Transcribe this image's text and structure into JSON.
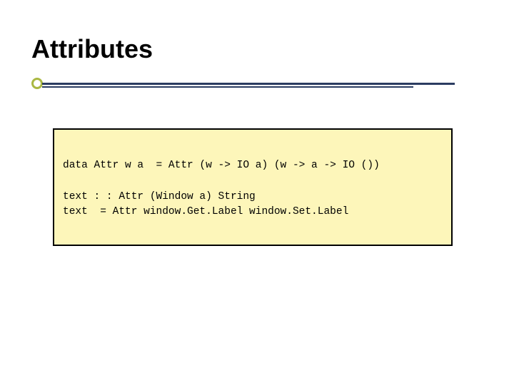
{
  "slide": {
    "title": "Attributes",
    "code": "data Attr w a  = Attr (w -> IO a) (w -> a -> IO ())\n\ntext : : Attr (Window a) String\ntext  = Attr window.Get.Label window.Set.Label"
  }
}
